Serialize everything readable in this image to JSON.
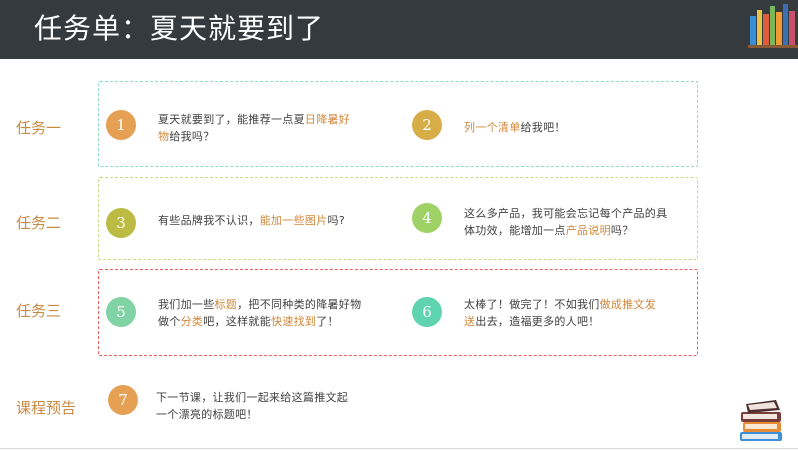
{
  "header": {
    "title": "任务单：夏天就要到了"
  },
  "tasks": [
    {
      "label": "任务一",
      "items": [
        {
          "num": "1",
          "t1": "夏天就要到了，能推荐一点夏",
          "h1": "日降暑好",
          "h2": "物",
          "t2": "给我吗？"
        },
        {
          "num": "2",
          "h1": "列一个清单",
          "t1": "给我吧！"
        }
      ]
    },
    {
      "label": "任务二",
      "items": [
        {
          "num": "3",
          "t1": "有些品牌我不认识，",
          "h1": "能加一些图片",
          "t2": "吗?"
        },
        {
          "num": "4",
          "t1": "这么多产品，我可能会忘记每个产品的具",
          "t2": "体功效，能增加一点",
          "h1": "产品说明",
          "t3": "吗？"
        }
      ]
    },
    {
      "label": "任务三",
      "items": [
        {
          "num": "5",
          "t1": "我们加一些",
          "h1": "标题",
          "t2": "，把不同种类的降暑好物",
          "t3": "做个",
          "h2": "分类",
          "t4": "吧，这样就能",
          "h3": "快速找到",
          "t5": "了！"
        },
        {
          "num": "6",
          "t1": "太棒了！做完了！不如我们",
          "h1": "做成推文发",
          "h2": "送",
          "t2": "出去，造福更多的人吧！"
        }
      ]
    }
  ],
  "preview": {
    "label": "课程预告",
    "num": "7",
    "line1": "下一节课，让我们一起来给这篇推文起",
    "line2": "一个漂亮的标题吧！"
  },
  "colors": {
    "header_bg": "#353a3e",
    "label": "#c98a44",
    "highlight": "#d2873a",
    "box1_border": "#8fd9c9",
    "box2_border": "#c9d98a",
    "box3_border": "#ef5a5a",
    "c1": "#e6a054",
    "c2": "#d6ad47",
    "c3": "#bcbc45",
    "c4": "#9fd266",
    "c5": "#7fd3a4",
    "c6": "#5fd4ae",
    "c7": "#e6a054"
  },
  "icons": [
    "books-shelf-icon",
    "book-stack-icon"
  ]
}
